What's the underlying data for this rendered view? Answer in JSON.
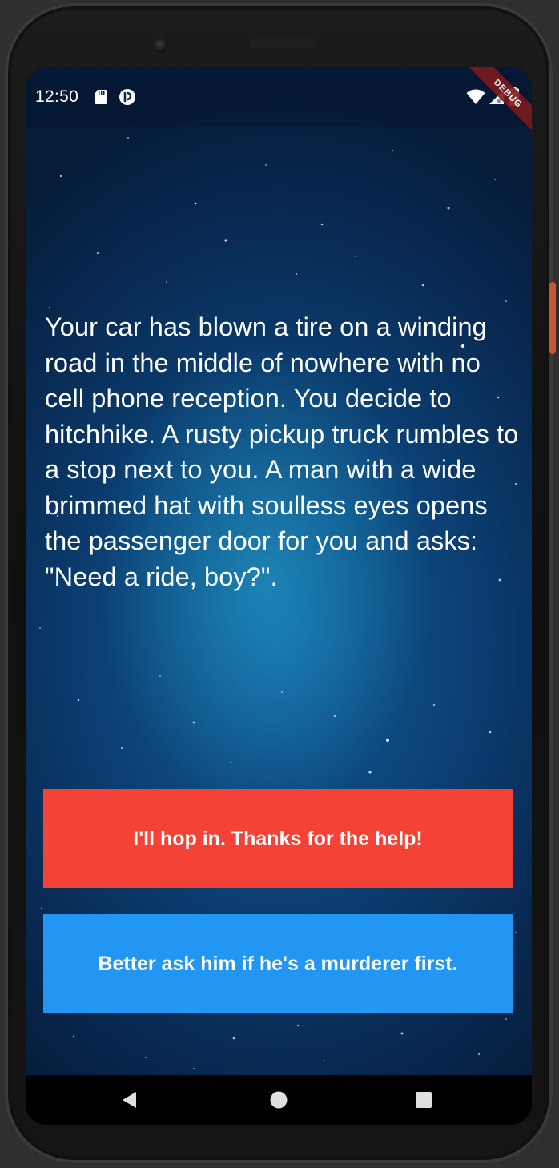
{
  "status_bar": {
    "time": "12:50",
    "icons": [
      "sd-card-icon",
      "app-notification-icon",
      "wifi-icon",
      "cell-signal-icon",
      "battery-icon"
    ]
  },
  "debug_banner": "DEBUG",
  "story": {
    "text": "Your car has blown a tire on a winding road in the middle of nowhere with no cell phone reception. You decide to hitchhike. A rusty pickup truck rumbles to a stop next to you. A man with a wide brimmed hat with soulless eyes opens the passenger door for you and asks: \"Need a ride, boy?\"."
  },
  "choices": {
    "choice1_label": "I'll hop in. Thanks for the help!",
    "choice2_label": "Better ask him if he's a murderer first."
  },
  "colors": {
    "choice1_bg": "#f44336",
    "choice2_bg": "#2196f3",
    "background": "#0b3f73"
  },
  "nav_bar": {
    "icons": [
      "back-icon",
      "home-icon",
      "recents-icon"
    ]
  }
}
